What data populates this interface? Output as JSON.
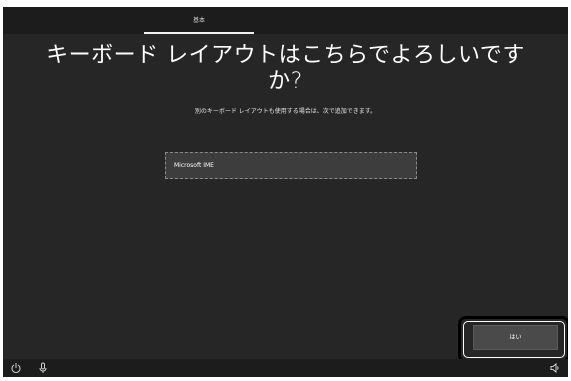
{
  "header": {
    "step_label": "基本"
  },
  "main": {
    "title_line1": "キーボード レイアウトはこちらでよろしいです",
    "title_line2": "か?",
    "subtitle": "別のキーボード レイアウトも使用する場合は、次で追加できます。",
    "layouts": [
      {
        "label": "Microsoft IME"
      }
    ]
  },
  "footer": {
    "yes_label": "はい",
    "icons": [
      "ease-of-access-icon",
      "microphone-icon",
      "volume-icon"
    ]
  }
}
